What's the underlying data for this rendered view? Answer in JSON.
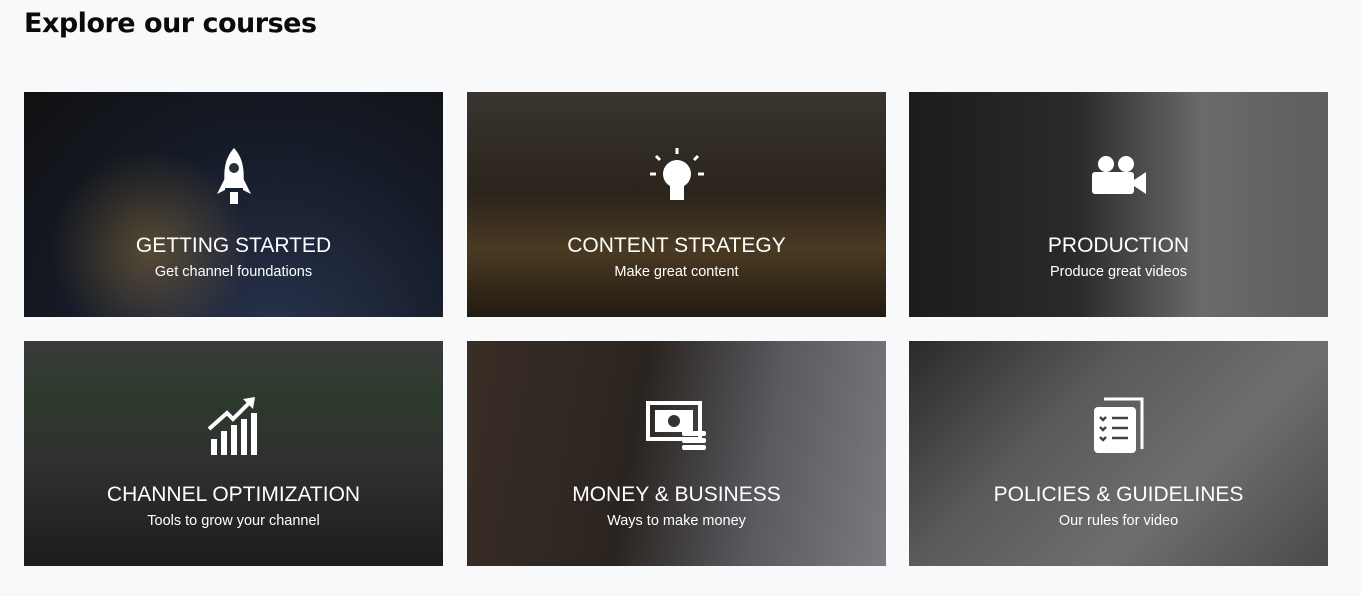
{
  "page_title": "Explore our courses",
  "courses": [
    {
      "title": "GETTING STARTED",
      "subtitle": "Get channel foundations",
      "icon": "rocket-icon"
    },
    {
      "title": "CONTENT STRATEGY",
      "subtitle": "Make great content",
      "icon": "lightbulb-icon"
    },
    {
      "title": "PRODUCTION",
      "subtitle": "Produce great videos",
      "icon": "video-camera-icon"
    },
    {
      "title": "CHANNEL OPTIMIZATION",
      "subtitle": "Tools to grow your channel",
      "icon": "growth-chart-icon"
    },
    {
      "title": "MONEY & BUSINESS",
      "subtitle": "Ways to make money",
      "icon": "money-icon"
    },
    {
      "title": "POLICIES & GUIDELINES",
      "subtitle": "Our rules for video",
      "icon": "checklist-icon"
    }
  ]
}
